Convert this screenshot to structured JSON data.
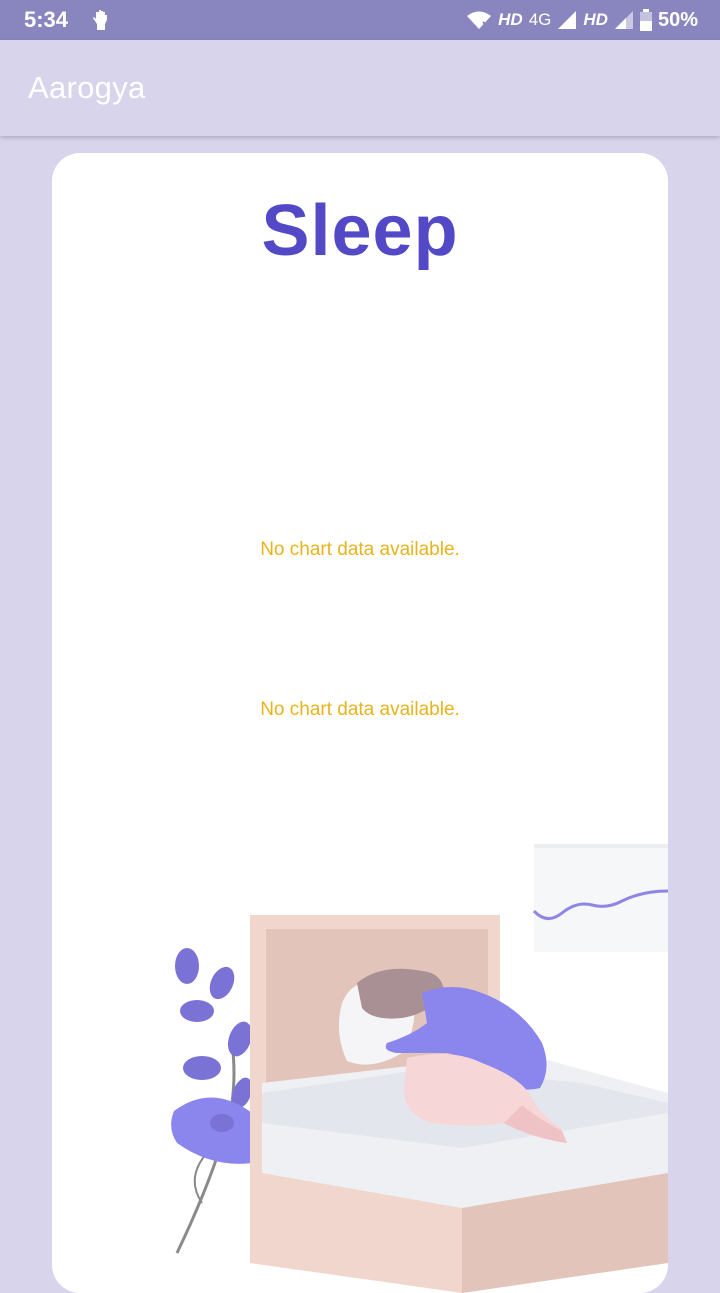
{
  "status_bar": {
    "time": "5:34",
    "hd_1": "HD",
    "network_1": "4G",
    "hd_2": "HD",
    "battery": "50%"
  },
  "app_bar": {
    "title": "Aarogya"
  },
  "card": {
    "heading": "Sleep",
    "chart_1_empty": "No chart data available.",
    "chart_2_empty": "No chart data available."
  },
  "colors": {
    "status_bar": "#8986bf",
    "background": "#d8d4eb",
    "heading": "#5349c7",
    "empty_text": "#e8b31c"
  },
  "icons": [
    "hand-notification-icon",
    "wifi-icon",
    "signal-icon",
    "battery-icon"
  ]
}
